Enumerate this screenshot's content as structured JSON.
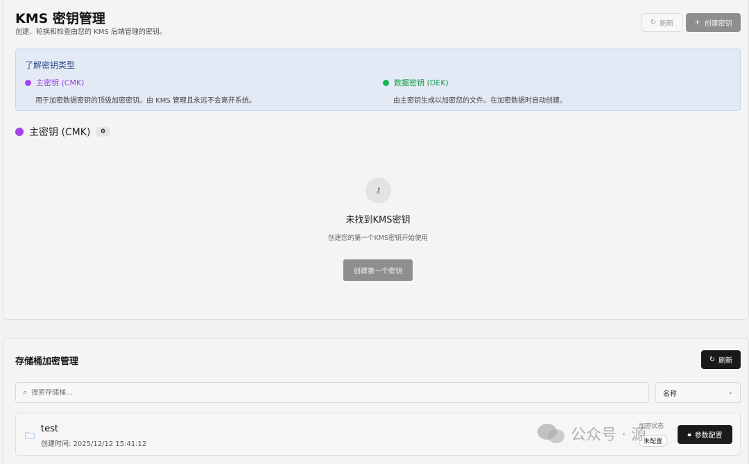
{
  "header": {
    "title": "KMS 密钥管理",
    "subtitle": "创建、轮换和检查由您的 KMS 后端管理的密钥。",
    "refresh_label": "刷新",
    "create_label": "创建密钥",
    "refresh_icon": "refresh-icon",
    "plus_icon": "+"
  },
  "info": {
    "title": "了解密钥类型",
    "cmk": {
      "label": "主密钥 (CMK)",
      "desc": "用于加密数据密钥的顶级加密密钥。由 KMS 管理且永远不会离开系统。",
      "color": "#a145e8"
    },
    "dek": {
      "label": "数据密钥 (DEK)",
      "desc": "由主密钥生成以加密您的文件。在加密数据时自动创建。",
      "color": "#16b455"
    }
  },
  "cmk_section": {
    "title": "主密钥 (CMK)",
    "count": "0"
  },
  "empty": {
    "icon": "key-icon",
    "title": "未找到KMS密钥",
    "desc": "创建您的第一个KMS密钥开始使用",
    "button": "创建第一个密钥"
  },
  "buckets": {
    "title": "存储桶加密管理",
    "refresh_label": "刷新",
    "search_placeholder": "搜索存储桶...",
    "sort_value": "名称",
    "items": [
      {
        "name": "test",
        "created": "创建时间: 2025/12/12 15:41:12",
        "enc_label": "加密状态",
        "enc_status": "未配置",
        "config_label": "参数配置"
      }
    ]
  },
  "watermark": {
    "text": "公众号 · 源"
  }
}
